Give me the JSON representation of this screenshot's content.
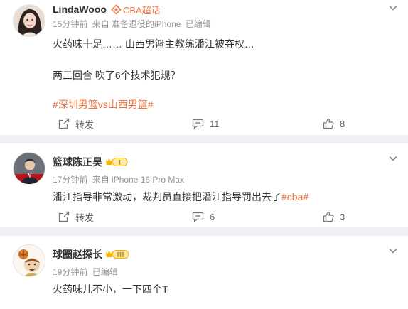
{
  "comments": [
    {
      "username": "LindaWooo",
      "super_topic": "CBA超话",
      "time": "15分钟前",
      "source": "来自 准备退役的iPhone",
      "edited": "已编辑",
      "lines": [
        "火药味十足…… 山西男篮主教练潘江被夺权…",
        "两三回合 吹了6个技术犯规？"
      ],
      "tag": "#深圳男篮vs山西男篮#",
      "forward_label": "转发",
      "comment_count": "11",
      "like_count": "8"
    },
    {
      "username": "篮球陈正昊",
      "level_badge": "I",
      "time": "17分钟前",
      "source": "来自 iPhone 16 Pro Max",
      "text": "潘江指导非常激动，裁判员直接把潘江指导罚出去了",
      "tag": "#cba#",
      "forward_label": "转发",
      "comment_count": "6",
      "like_count": "3"
    },
    {
      "username": "球圈赵探长",
      "level_badge": "III",
      "time": "19分钟前",
      "edited": "已编辑",
      "text": "火药味儿不小，一下四个T"
    }
  ],
  "colors": {
    "accent": "#eb7340",
    "badge_gold": "#f2b400",
    "meta_gray": "#939393",
    "page_bg": "#f0f1f4"
  },
  "icons": [
    "more-chevron-icon",
    "super-topic-icon",
    "forward-icon",
    "comment-icon",
    "like-icon",
    "level-crown-icon"
  ]
}
